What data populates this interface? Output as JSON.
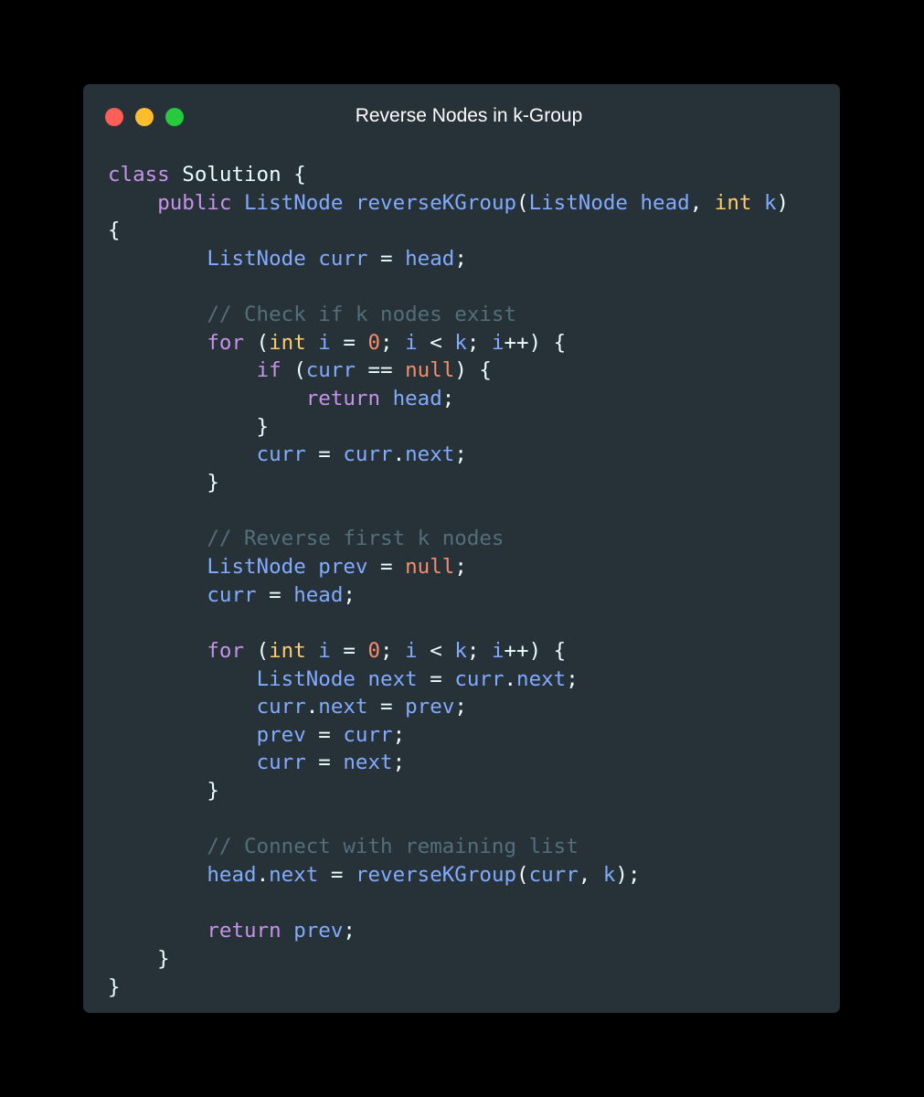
{
  "window": {
    "title": "Reverse Nodes in k-Group",
    "controls": [
      {
        "name": "close",
        "color": "#ff5f56"
      },
      {
        "name": "minimize",
        "color": "#ffbd2e"
      },
      {
        "name": "maximize",
        "color": "#27c93f"
      }
    ]
  },
  "colors": {
    "background": "#263238",
    "keyword": "#c792ea",
    "type": "#82aaff",
    "identifier": "#82aaff",
    "primitive": "#ffcb6b",
    "number": "#f78c6c",
    "literal": "#f78c6c",
    "comment": "#546e7a",
    "plain": "#eeffff"
  },
  "code": [
    [
      [
        "kw",
        "class"
      ],
      [
        "p",
        " Solution {"
      ]
    ],
    [
      [
        "p",
        "    "
      ],
      [
        "kw",
        "public"
      ],
      [
        "p",
        " "
      ],
      [
        "ty",
        "ListNode"
      ],
      [
        "p",
        " "
      ],
      [
        "id",
        "reverseKGroup"
      ],
      [
        "p",
        "("
      ],
      [
        "ty",
        "ListNode"
      ],
      [
        "p",
        " "
      ],
      [
        "id",
        "head"
      ],
      [
        "p",
        ", "
      ],
      [
        "pr",
        "int"
      ],
      [
        "p",
        " "
      ],
      [
        "id",
        "k"
      ],
      [
        "p",
        ")"
      ]
    ],
    [
      [
        "p",
        "{"
      ]
    ],
    [
      [
        "p",
        "        "
      ],
      [
        "ty",
        "ListNode"
      ],
      [
        "p",
        " "
      ],
      [
        "id",
        "curr"
      ],
      [
        "p",
        " = "
      ],
      [
        "id",
        "head"
      ],
      [
        "p",
        ";"
      ]
    ],
    [],
    [
      [
        "p",
        "        "
      ],
      [
        "cm",
        "// Check if k nodes exist"
      ]
    ],
    [
      [
        "p",
        "        "
      ],
      [
        "kw",
        "for"
      ],
      [
        "p",
        " ("
      ],
      [
        "pr",
        "int"
      ],
      [
        "p",
        " "
      ],
      [
        "id",
        "i"
      ],
      [
        "p",
        " = "
      ],
      [
        "num",
        "0"
      ],
      [
        "p",
        "; "
      ],
      [
        "id",
        "i"
      ],
      [
        "p",
        " < "
      ],
      [
        "id",
        "k"
      ],
      [
        "p",
        "; "
      ],
      [
        "id",
        "i"
      ],
      [
        "p",
        "++) {"
      ]
    ],
    [
      [
        "p",
        "            "
      ],
      [
        "kw",
        "if"
      ],
      [
        "p",
        " ("
      ],
      [
        "id",
        "curr"
      ],
      [
        "p",
        " == "
      ],
      [
        "lit",
        "null"
      ],
      [
        "p",
        ") {"
      ]
    ],
    [
      [
        "p",
        "                "
      ],
      [
        "kw",
        "return"
      ],
      [
        "p",
        " "
      ],
      [
        "id",
        "head"
      ],
      [
        "p",
        ";"
      ]
    ],
    [
      [
        "p",
        "            }"
      ]
    ],
    [
      [
        "p",
        "            "
      ],
      [
        "id",
        "curr"
      ],
      [
        "p",
        " = "
      ],
      [
        "id",
        "curr"
      ],
      [
        "p",
        "."
      ],
      [
        "id",
        "next"
      ],
      [
        "p",
        ";"
      ]
    ],
    [
      [
        "p",
        "        }"
      ]
    ],
    [],
    [
      [
        "p",
        "        "
      ],
      [
        "cm",
        "// Reverse first k nodes"
      ]
    ],
    [
      [
        "p",
        "        "
      ],
      [
        "ty",
        "ListNode"
      ],
      [
        "p",
        " "
      ],
      [
        "id",
        "prev"
      ],
      [
        "p",
        " = "
      ],
      [
        "lit",
        "null"
      ],
      [
        "p",
        ";"
      ]
    ],
    [
      [
        "p",
        "        "
      ],
      [
        "id",
        "curr"
      ],
      [
        "p",
        " = "
      ],
      [
        "id",
        "head"
      ],
      [
        "p",
        ";"
      ]
    ],
    [],
    [
      [
        "p",
        "        "
      ],
      [
        "kw",
        "for"
      ],
      [
        "p",
        " ("
      ],
      [
        "pr",
        "int"
      ],
      [
        "p",
        " "
      ],
      [
        "id",
        "i"
      ],
      [
        "p",
        " = "
      ],
      [
        "num",
        "0"
      ],
      [
        "p",
        "; "
      ],
      [
        "id",
        "i"
      ],
      [
        "p",
        " < "
      ],
      [
        "id",
        "k"
      ],
      [
        "p",
        "; "
      ],
      [
        "id",
        "i"
      ],
      [
        "p",
        "++) {"
      ]
    ],
    [
      [
        "p",
        "            "
      ],
      [
        "ty",
        "ListNode"
      ],
      [
        "p",
        " "
      ],
      [
        "id",
        "next"
      ],
      [
        "p",
        " = "
      ],
      [
        "id",
        "curr"
      ],
      [
        "p",
        "."
      ],
      [
        "id",
        "next"
      ],
      [
        "p",
        ";"
      ]
    ],
    [
      [
        "p",
        "            "
      ],
      [
        "id",
        "curr"
      ],
      [
        "p",
        "."
      ],
      [
        "id",
        "next"
      ],
      [
        "p",
        " = "
      ],
      [
        "id",
        "prev"
      ],
      [
        "p",
        ";"
      ]
    ],
    [
      [
        "p",
        "            "
      ],
      [
        "id",
        "prev"
      ],
      [
        "p",
        " = "
      ],
      [
        "id",
        "curr"
      ],
      [
        "p",
        ";"
      ]
    ],
    [
      [
        "p",
        "            "
      ],
      [
        "id",
        "curr"
      ],
      [
        "p",
        " = "
      ],
      [
        "id",
        "next"
      ],
      [
        "p",
        ";"
      ]
    ],
    [
      [
        "p",
        "        }"
      ]
    ],
    [],
    [
      [
        "p",
        "        "
      ],
      [
        "cm",
        "// Connect with remaining list"
      ]
    ],
    [
      [
        "p",
        "        "
      ],
      [
        "id",
        "head"
      ],
      [
        "p",
        "."
      ],
      [
        "id",
        "next"
      ],
      [
        "p",
        " = "
      ],
      [
        "id",
        "reverseKGroup"
      ],
      [
        "p",
        "("
      ],
      [
        "id",
        "curr"
      ],
      [
        "p",
        ", "
      ],
      [
        "id",
        "k"
      ],
      [
        "p",
        ");"
      ]
    ],
    [],
    [
      [
        "p",
        "        "
      ],
      [
        "kw",
        "return"
      ],
      [
        "p",
        " "
      ],
      [
        "id",
        "prev"
      ],
      [
        "p",
        ";"
      ]
    ],
    [
      [
        "p",
        "    }"
      ]
    ],
    [
      [
        "p",
        "}"
      ]
    ]
  ]
}
